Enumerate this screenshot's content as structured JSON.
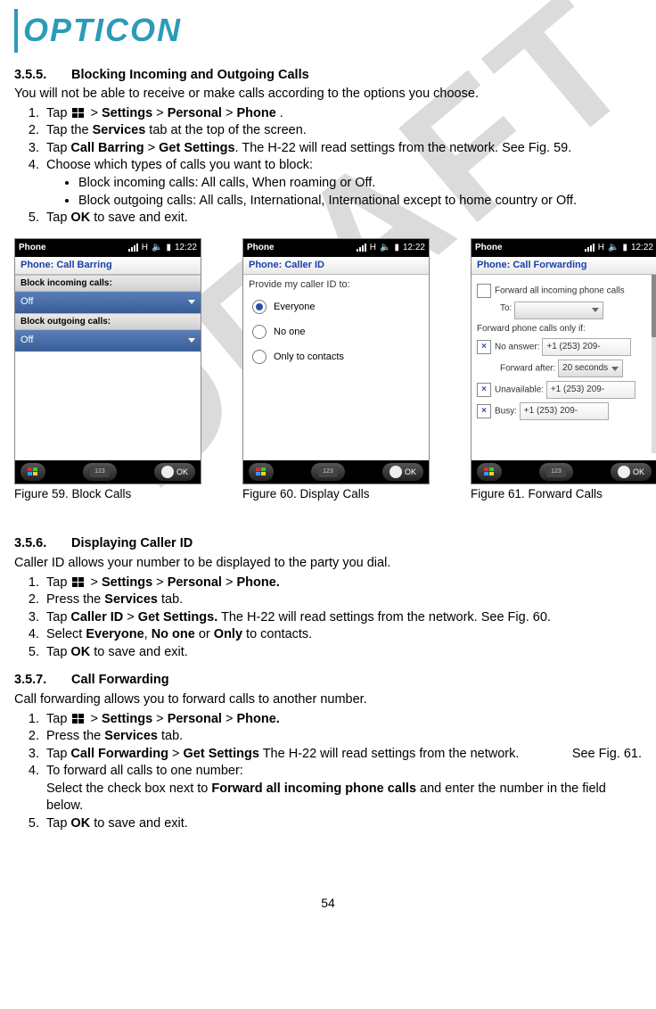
{
  "logo": "OPTICON",
  "watermark": "DRAFT",
  "page_number": "54",
  "sec355": {
    "num": "3.5.5.",
    "title": "Blocking Incoming and Outgoing Calls",
    "intro": "You will not be able to receive or make calls according to the options you choose.",
    "steps": {
      "s1a": "Tap ",
      "s1b": " > ",
      "s1c": "Settings",
      "s1d": " > ",
      "s1e": "Personal",
      "s1f": " > ",
      "s1g": "Phone",
      "s1h": " .",
      "s2a": "Tap the ",
      "s2b": "Services",
      "s2c": " tab at the top of the screen.",
      "s3a": "Tap ",
      "s3b": "Call Barring",
      "s3c": " > ",
      "s3d": "Get Settings",
      "s3e": ". The H-22 will read settings from the network. See Fig. 59.",
      "s4": "Choose which types of calls you want to block:",
      "s4sub1": "Block incoming calls: All calls, When roaming or Off.",
      "s4sub2": "Block outgoing calls: All calls, International, International except to home country or Off.",
      "s5a": "Tap ",
      "s5b": "OK",
      "s5c": " to save and exit."
    }
  },
  "sec356": {
    "num": "3.5.6.",
    "title": "Displaying Caller ID",
    "intro": "Caller ID allows your number to be displayed to the party you dial.",
    "steps": {
      "s1a": "Tap ",
      "s1b": " > ",
      "s1c": "Settings",
      "s1d": " > ",
      "s1e": "Personal",
      "s1f": " > ",
      "s1g": "Phone.",
      "s2a": "Press the ",
      "s2b": "Services",
      "s2c": " tab.",
      "s3a": "Tap ",
      "s3b": "Caller ID",
      "s3c": " > ",
      "s3d": "Get Settings.",
      "s3e": " The H-22 will read settings from the network. See Fig. 60.",
      "s4a": "Select ",
      "s4b": "Everyone",
      "s4c": ", ",
      "s4d": "No one",
      "s4e": " or ",
      "s4f": "Only",
      "s4g": " to contacts.",
      "s5a": "Tap ",
      "s5b": "OK",
      "s5c": " to save and exit."
    }
  },
  "sec357": {
    "num": "3.5.7.",
    "title": "Call Forwarding",
    "intro": "Call forwarding allows you to forward calls to another number.",
    "steps": {
      "s1a": "Tap ",
      "s1b": " > ",
      "s1c": "Settings",
      "s1d": " > ",
      "s1e": "Personal",
      "s1f": " > ",
      "s1g": "Phone.",
      "s2a": "Press the ",
      "s2b": "Services",
      "s2c": " tab.",
      "s3a": "Tap ",
      "s3b": "Call Forwarding",
      "s3c": " > ",
      "s3d": "Get Settings",
      "s3e": " The H-22 will read settings from the network.",
      "s3f": "See Fig. 61.",
      "s4a": "To forward all calls to one number:",
      "s4b": "Select the check box next to ",
      "s4c": "Forward all incoming phone calls",
      "s4d": " and enter the number in the field below.",
      "s5a": "Tap ",
      "s5b": "OK",
      "s5c": " to save and exit."
    }
  },
  "figs": {
    "status_app": "Phone",
    "status_time": "12:22",
    "kbd": "123",
    "ok": "OK",
    "f59": {
      "subtitle": "Phone: Call Barring",
      "label1": "Block incoming calls:",
      "val1": "Off",
      "label2": "Block outgoing calls:",
      "val2": "Off",
      "caption": "Figure 59. Block Calls"
    },
    "f60": {
      "subtitle": "Phone: Caller ID",
      "prompt": "Provide my caller ID to:",
      "opt1": "Everyone",
      "opt2": "No one",
      "opt3": "Only to contacts",
      "caption": "Figure 60. Display Calls"
    },
    "f61": {
      "subtitle": "Phone: Call Forwarding",
      "chk_all": "Forward all incoming phone calls",
      "to": "To:",
      "onlyif": "Forward phone calls only if:",
      "noanswer": "No answer:",
      "noanswer_val": "+1 (253) 209-",
      "fwdafter": "Forward after:",
      "fwdafter_val": "20 seconds",
      "unavail": "Unavailable:",
      "unavail_val": "+1 (253) 209-",
      "busy": "Busy:",
      "busy_val": "+1 (253) 209-",
      "caption": "Figure 61. Forward Calls"
    }
  }
}
